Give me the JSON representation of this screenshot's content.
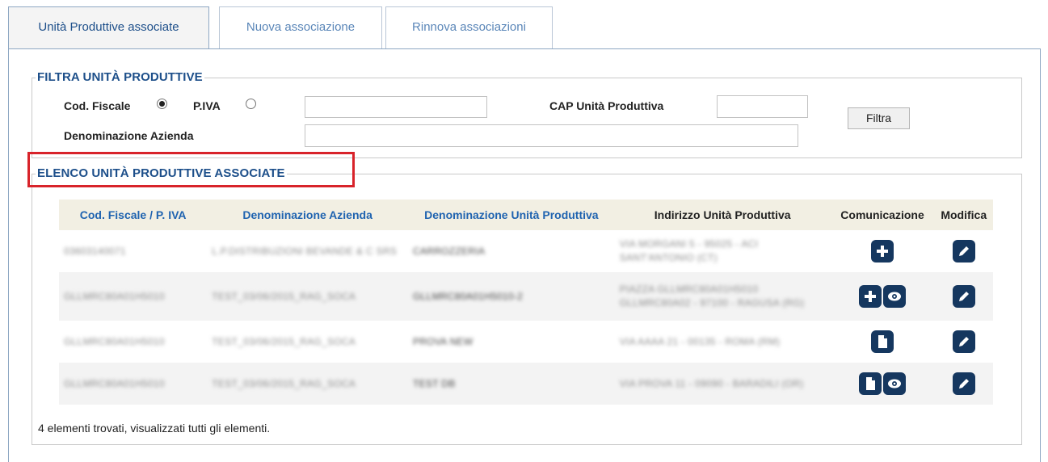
{
  "tabs": [
    {
      "label": "Unità Produttive associate",
      "active": true
    },
    {
      "label": "Nuova associazione",
      "active": false
    },
    {
      "label": "Rinnova associazioni",
      "active": false
    }
  ],
  "filter": {
    "legend": "FILTRA UNITÀ PRODUTTIVE",
    "cod_fiscale_label": "Cod. Fiscale",
    "piva_label": "P.IVA",
    "selected_option": "Cod. Fiscale",
    "cod_value": "",
    "cap_label": "CAP Unità Produttiva",
    "cap_value": "",
    "denominazione_label": "Denominazione Azienda",
    "denominazione_value": "",
    "filtra_button": "Filtra"
  },
  "list": {
    "legend": "ELENCO UNITÀ PRODUTTIVE ASSOCIATE",
    "columns": [
      "Cod. Fiscale / P. IVA",
      "Denominazione Azienda",
      "Denominazione Unità Produttiva",
      "Indirizzo Unità Produttiva",
      "Comunicazione",
      "Modifica"
    ],
    "rows": [
      {
        "cf": "03603140071",
        "azienda": "L.P.DISTRIBUZIONI BEVANDE & C SRS",
        "unita": "CARROZZERIA",
        "indirizzo": "VIA MORGANI 5 - 95025 - ACI SANT'ANTONIO (CT)",
        "comunicazione_icons": [
          "plus-icon"
        ],
        "modifica_icon": "edit-icon"
      },
      {
        "cf": "GLLMRC80A01H5010",
        "azienda": "TEST_03/06/2015_RAG_SOCA",
        "unita": "GLLMRC80A01H5010-2",
        "indirizzo": "PIAZZA GLLMRC80A01H5010 GLLMRC80A02 - 97100 - RAGUSA (RG)",
        "comunicazione_icons": [
          "plus-icon",
          "eye-icon"
        ],
        "modifica_icon": "edit-icon"
      },
      {
        "cf": "GLLMRC80A01H5010",
        "azienda": "TEST_03/06/2015_RAG_SOCA",
        "unita": "PROVA NEW",
        "indirizzo": "VIA AAAA 21 - 00135 - ROMA (RM)",
        "comunicazione_icons": [
          "document-icon"
        ],
        "modifica_icon": "edit-icon"
      },
      {
        "cf": "GLLMRC80A01H5010",
        "azienda": "TEST_03/06/2015_RAG_SOCA",
        "unita": "TEST DB",
        "indirizzo": "VIA PROVA 11 - 09090 - BARADILI (OR)",
        "comunicazione_icons": [
          "document-icon",
          "eye-icon"
        ],
        "modifica_icon": "edit-icon"
      }
    ],
    "footer": "4 elementi trovati, visualizzati tutti gli elementi."
  },
  "colors": {
    "accent": "#1d4f8a",
    "link": "#1f63b0",
    "icon_bg": "#15375f",
    "highlight": "#d8232a",
    "header_bg": "#f2efe3"
  }
}
